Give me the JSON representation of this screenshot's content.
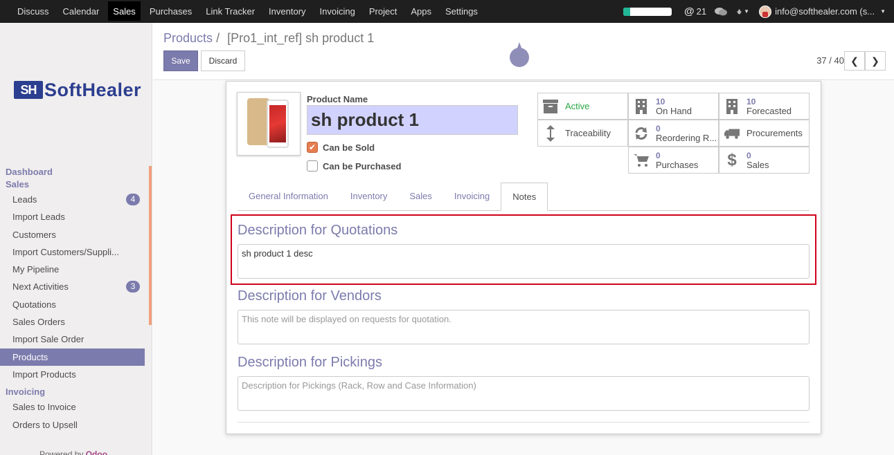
{
  "topbar": {
    "menu": [
      "Discuss",
      "Calendar",
      "Sales",
      "Purchases",
      "Link Tracker",
      "Inventory",
      "Invoicing",
      "Project",
      "Apps",
      "Settings"
    ],
    "active_menu": "Sales",
    "progress_percent": 15,
    "mentions_count": "21",
    "user_email": "info@softhealer.com (s..."
  },
  "sidebar": {
    "logo_mark": "SH",
    "logo_text": "SoftHealer",
    "sections": [
      {
        "title": "Dashboard",
        "items": []
      },
      {
        "title": "Sales",
        "items": [
          {
            "label": "Leads",
            "badge": "4"
          },
          {
            "label": "Import Leads"
          },
          {
            "label": "Customers"
          },
          {
            "label": "Import Customers/Suppli..."
          },
          {
            "label": "My Pipeline"
          },
          {
            "label": "Next Activities",
            "badge": "3"
          },
          {
            "label": "Quotations"
          },
          {
            "label": "Sales Orders"
          },
          {
            "label": "Import Sale Order"
          },
          {
            "label": "Products",
            "active": true
          },
          {
            "label": "Import Products"
          }
        ]
      },
      {
        "title": "Invoicing",
        "items": [
          {
            "label": "Sales to Invoice"
          },
          {
            "label": "Orders to Upsell"
          }
        ]
      }
    ],
    "powered_prefix": "Powered by",
    "powered_brand": "Odoo"
  },
  "control": {
    "breadcrumb_parent": "Products",
    "breadcrumb_sep": "/",
    "breadcrumb_current": "[Pro1_int_ref] sh product 1",
    "save_label": "Save",
    "discard_label": "Discard",
    "pager": "37 / 40"
  },
  "form": {
    "product_name_label": "Product Name",
    "product_name": "sh product 1",
    "can_be_sold_label": "Can be Sold",
    "can_be_sold": true,
    "can_be_purchased_label": "Can be Purchased",
    "can_be_purchased": false,
    "stats": {
      "active": "Active",
      "on_hand_num": "10",
      "on_hand": "On Hand",
      "forecasted_num": "10",
      "forecasted": "Forecasted",
      "traceability": "Traceability",
      "reordering_num": "0",
      "reordering": "Reordering R...",
      "procurements": "Procurements",
      "purchases_num": "0",
      "purchases": "Purchases",
      "sales_num": "0",
      "sales": "Sales"
    },
    "tabs": [
      "General Information",
      "Inventory",
      "Sales",
      "Invoicing",
      "Notes"
    ],
    "active_tab": "Notes",
    "desc_quotations_title": "Description for Quotations",
    "desc_quotations_value": "sh product 1 desc",
    "desc_vendors_title": "Description for Vendors",
    "desc_vendors_placeholder": "This note will be displayed on requests for quotation.",
    "desc_pickings_title": "Description for Pickings",
    "desc_pickings_placeholder": "Description for Pickings (Rack, Row and Case Information)"
  },
  "colors": {
    "brand": "#7c7bad",
    "active_green": "#28a745",
    "highlight_red": "#d0021b"
  }
}
